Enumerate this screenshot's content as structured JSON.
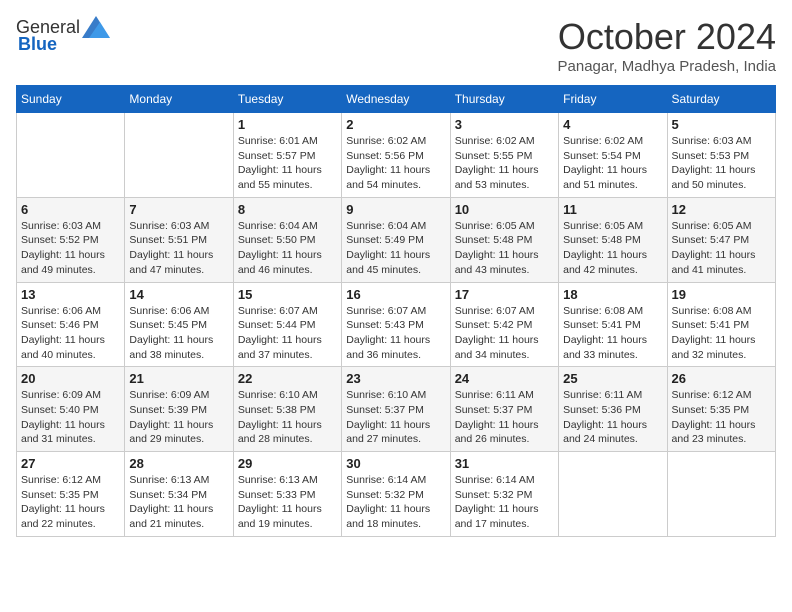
{
  "logo": {
    "general": "General",
    "blue": "Blue"
  },
  "header": {
    "month": "October 2024",
    "location": "Panagar, Madhya Pradesh, India"
  },
  "weekdays": [
    "Sunday",
    "Monday",
    "Tuesday",
    "Wednesday",
    "Thursday",
    "Friday",
    "Saturday"
  ],
  "weeks": [
    [
      {
        "day": "",
        "sunrise": "",
        "sunset": "",
        "daylight": ""
      },
      {
        "day": "",
        "sunrise": "",
        "sunset": "",
        "daylight": ""
      },
      {
        "day": "1",
        "sunrise": "Sunrise: 6:01 AM",
        "sunset": "Sunset: 5:57 PM",
        "daylight": "Daylight: 11 hours and 55 minutes."
      },
      {
        "day": "2",
        "sunrise": "Sunrise: 6:02 AM",
        "sunset": "Sunset: 5:56 PM",
        "daylight": "Daylight: 11 hours and 54 minutes."
      },
      {
        "day": "3",
        "sunrise": "Sunrise: 6:02 AM",
        "sunset": "Sunset: 5:55 PM",
        "daylight": "Daylight: 11 hours and 53 minutes."
      },
      {
        "day": "4",
        "sunrise": "Sunrise: 6:02 AM",
        "sunset": "Sunset: 5:54 PM",
        "daylight": "Daylight: 11 hours and 51 minutes."
      },
      {
        "day": "5",
        "sunrise": "Sunrise: 6:03 AM",
        "sunset": "Sunset: 5:53 PM",
        "daylight": "Daylight: 11 hours and 50 minutes."
      }
    ],
    [
      {
        "day": "6",
        "sunrise": "Sunrise: 6:03 AM",
        "sunset": "Sunset: 5:52 PM",
        "daylight": "Daylight: 11 hours and 49 minutes."
      },
      {
        "day": "7",
        "sunrise": "Sunrise: 6:03 AM",
        "sunset": "Sunset: 5:51 PM",
        "daylight": "Daylight: 11 hours and 47 minutes."
      },
      {
        "day": "8",
        "sunrise": "Sunrise: 6:04 AM",
        "sunset": "Sunset: 5:50 PM",
        "daylight": "Daylight: 11 hours and 46 minutes."
      },
      {
        "day": "9",
        "sunrise": "Sunrise: 6:04 AM",
        "sunset": "Sunset: 5:49 PM",
        "daylight": "Daylight: 11 hours and 45 minutes."
      },
      {
        "day": "10",
        "sunrise": "Sunrise: 6:05 AM",
        "sunset": "Sunset: 5:48 PM",
        "daylight": "Daylight: 11 hours and 43 minutes."
      },
      {
        "day": "11",
        "sunrise": "Sunrise: 6:05 AM",
        "sunset": "Sunset: 5:48 PM",
        "daylight": "Daylight: 11 hours and 42 minutes."
      },
      {
        "day": "12",
        "sunrise": "Sunrise: 6:05 AM",
        "sunset": "Sunset: 5:47 PM",
        "daylight": "Daylight: 11 hours and 41 minutes."
      }
    ],
    [
      {
        "day": "13",
        "sunrise": "Sunrise: 6:06 AM",
        "sunset": "Sunset: 5:46 PM",
        "daylight": "Daylight: 11 hours and 40 minutes."
      },
      {
        "day": "14",
        "sunrise": "Sunrise: 6:06 AM",
        "sunset": "Sunset: 5:45 PM",
        "daylight": "Daylight: 11 hours and 38 minutes."
      },
      {
        "day": "15",
        "sunrise": "Sunrise: 6:07 AM",
        "sunset": "Sunset: 5:44 PM",
        "daylight": "Daylight: 11 hours and 37 minutes."
      },
      {
        "day": "16",
        "sunrise": "Sunrise: 6:07 AM",
        "sunset": "Sunset: 5:43 PM",
        "daylight": "Daylight: 11 hours and 36 minutes."
      },
      {
        "day": "17",
        "sunrise": "Sunrise: 6:07 AM",
        "sunset": "Sunset: 5:42 PM",
        "daylight": "Daylight: 11 hours and 34 minutes."
      },
      {
        "day": "18",
        "sunrise": "Sunrise: 6:08 AM",
        "sunset": "Sunset: 5:41 PM",
        "daylight": "Daylight: 11 hours and 33 minutes."
      },
      {
        "day": "19",
        "sunrise": "Sunrise: 6:08 AM",
        "sunset": "Sunset: 5:41 PM",
        "daylight": "Daylight: 11 hours and 32 minutes."
      }
    ],
    [
      {
        "day": "20",
        "sunrise": "Sunrise: 6:09 AM",
        "sunset": "Sunset: 5:40 PM",
        "daylight": "Daylight: 11 hours and 31 minutes."
      },
      {
        "day": "21",
        "sunrise": "Sunrise: 6:09 AM",
        "sunset": "Sunset: 5:39 PM",
        "daylight": "Daylight: 11 hours and 29 minutes."
      },
      {
        "day": "22",
        "sunrise": "Sunrise: 6:10 AM",
        "sunset": "Sunset: 5:38 PM",
        "daylight": "Daylight: 11 hours and 28 minutes."
      },
      {
        "day": "23",
        "sunrise": "Sunrise: 6:10 AM",
        "sunset": "Sunset: 5:37 PM",
        "daylight": "Daylight: 11 hours and 27 minutes."
      },
      {
        "day": "24",
        "sunrise": "Sunrise: 6:11 AM",
        "sunset": "Sunset: 5:37 PM",
        "daylight": "Daylight: 11 hours and 26 minutes."
      },
      {
        "day": "25",
        "sunrise": "Sunrise: 6:11 AM",
        "sunset": "Sunset: 5:36 PM",
        "daylight": "Daylight: 11 hours and 24 minutes."
      },
      {
        "day": "26",
        "sunrise": "Sunrise: 6:12 AM",
        "sunset": "Sunset: 5:35 PM",
        "daylight": "Daylight: 11 hours and 23 minutes."
      }
    ],
    [
      {
        "day": "27",
        "sunrise": "Sunrise: 6:12 AM",
        "sunset": "Sunset: 5:35 PM",
        "daylight": "Daylight: 11 hours and 22 minutes."
      },
      {
        "day": "28",
        "sunrise": "Sunrise: 6:13 AM",
        "sunset": "Sunset: 5:34 PM",
        "daylight": "Daylight: 11 hours and 21 minutes."
      },
      {
        "day": "29",
        "sunrise": "Sunrise: 6:13 AM",
        "sunset": "Sunset: 5:33 PM",
        "daylight": "Daylight: 11 hours and 19 minutes."
      },
      {
        "day": "30",
        "sunrise": "Sunrise: 6:14 AM",
        "sunset": "Sunset: 5:32 PM",
        "daylight": "Daylight: 11 hours and 18 minutes."
      },
      {
        "day": "31",
        "sunrise": "Sunrise: 6:14 AM",
        "sunset": "Sunset: 5:32 PM",
        "daylight": "Daylight: 11 hours and 17 minutes."
      },
      {
        "day": "",
        "sunrise": "",
        "sunset": "",
        "daylight": ""
      },
      {
        "day": "",
        "sunrise": "",
        "sunset": "",
        "daylight": ""
      }
    ]
  ]
}
